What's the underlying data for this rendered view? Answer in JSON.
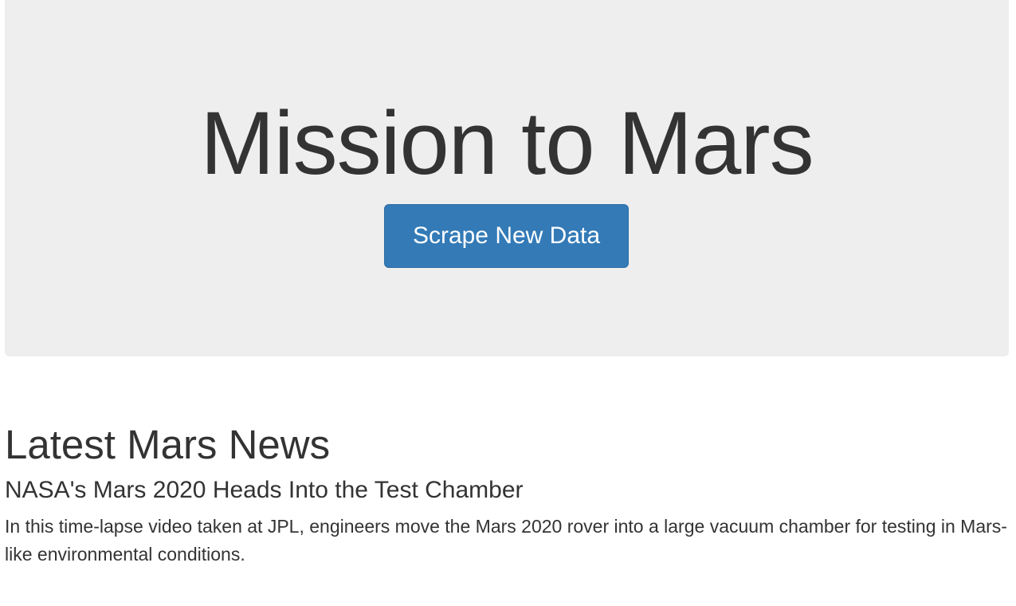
{
  "header": {
    "title": "Mission to Mars",
    "scrape_button_label": "Scrape New Data",
    "background_color": "#eeeeee",
    "button_color": "#337ab7"
  },
  "news": {
    "section_heading": "Latest Mars News",
    "title": "NASA's Mars 2020 Heads Into the Test Chamber",
    "teaser": "In this time-lapse video taken at JPL, engineers move the Mars 2020 rover into a large vacuum chamber for testing in Mars-like environmental conditions."
  }
}
